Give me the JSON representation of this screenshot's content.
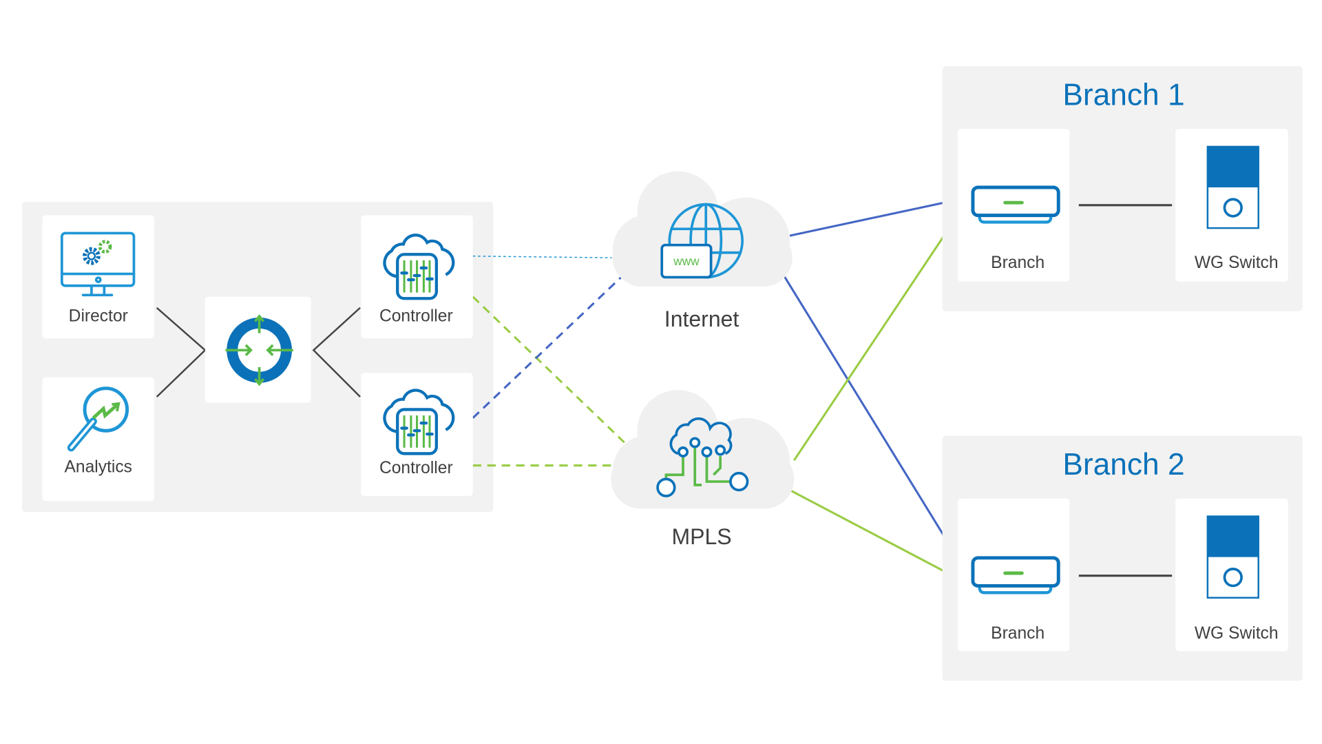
{
  "colors": {
    "blue": "#0b72b9",
    "light_blue": "#1e96d6",
    "green": "#5bba47",
    "link_blue": "#4466c4",
    "link_green": "#99cc44",
    "panel": "#f2f2f2",
    "text": "#404040"
  },
  "headquarters": {
    "director": {
      "label": "Director",
      "icon": "monitor-gear-icon"
    },
    "analytics": {
      "label": "Analytics",
      "icon": "magnifier-trend-icon"
    },
    "hub": {
      "icon": "converge-arrows-icon"
    },
    "controller_1": {
      "label": "Controller",
      "icon": "cloud-controller-icon"
    },
    "controller_2": {
      "label": "Controller",
      "icon": "cloud-controller-icon"
    }
  },
  "networks": {
    "internet": {
      "label": "Internet",
      "badge": "www",
      "icon": "globe-cloud-icon"
    },
    "mpls": {
      "label": "MPLS",
      "icon": "circuit-cloud-icon"
    }
  },
  "branches": [
    {
      "title": "Branch 1",
      "device": "Branch",
      "switch": "WG Switch"
    },
    {
      "title": "Branch 2",
      "device": "Branch",
      "switch": "WG Switch"
    }
  ]
}
